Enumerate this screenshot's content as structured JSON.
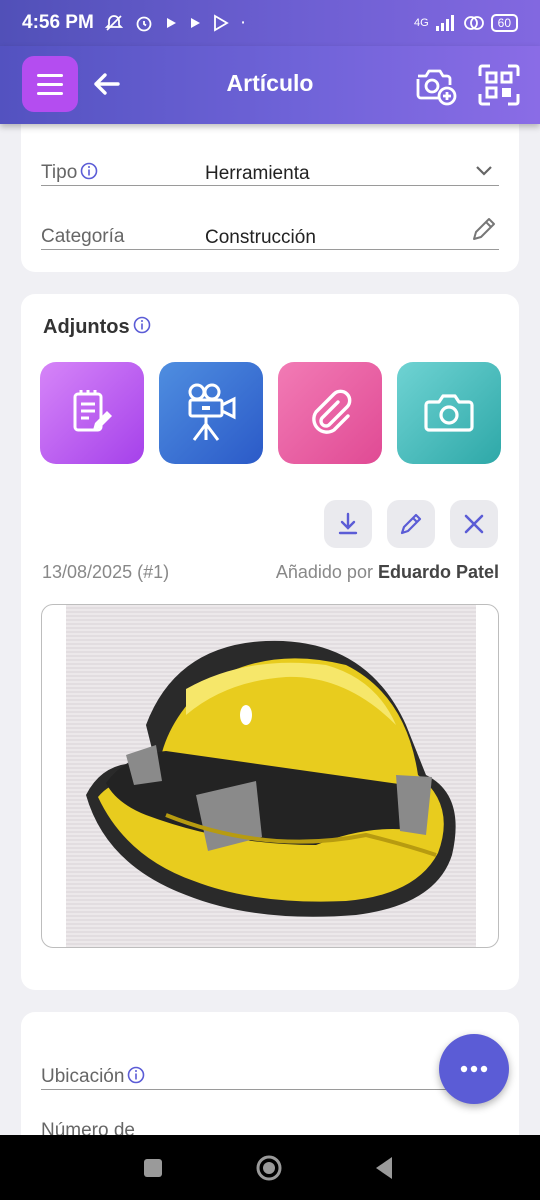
{
  "status_bar": {
    "time": "4:56 PM",
    "network": "4G",
    "battery": "60"
  },
  "app_bar": {
    "title": "Artículo"
  },
  "details": {
    "tipo_label": "Tipo",
    "tipo_value": "Herramienta",
    "categoria_label": "Categoría",
    "categoria_value": "Construcción"
  },
  "attachments": {
    "title": "Adjuntos",
    "buttons": [
      "notes-icon",
      "video-camera-icon",
      "paperclip-icon",
      "camera-icon"
    ],
    "date": "13/08/2025 (#1)",
    "added_by_prefix": "Añadido por",
    "added_by_name": "Eduardo Patel"
  },
  "location": {
    "ubicacion_label": "Ubicación",
    "numero_label": "Número de"
  },
  "colors": {
    "primary": "#5b5cd6",
    "menu_button": "#b44df0"
  }
}
